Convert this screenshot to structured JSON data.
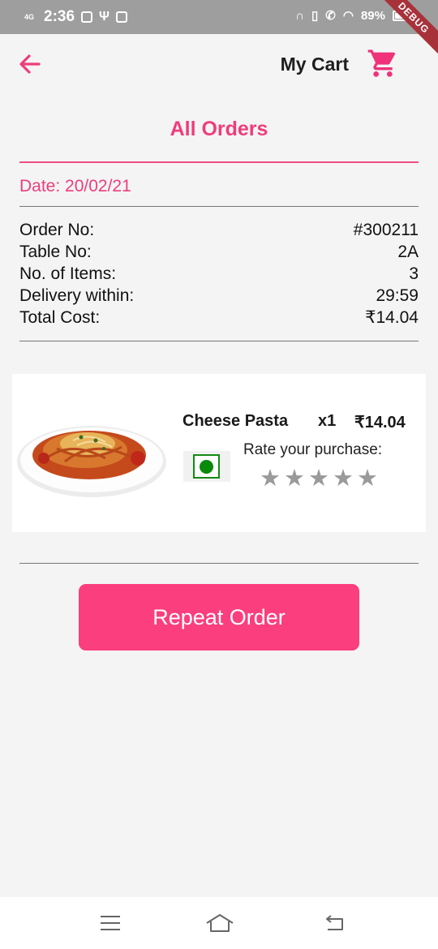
{
  "status_bar": {
    "network": "4G",
    "time": "2:36",
    "battery": "89%"
  },
  "debug_banner": "DEBUG",
  "header": {
    "cart_label": "My Cart"
  },
  "page_title": "All Orders",
  "order": {
    "date": "Date: 20/02/21",
    "details": [
      {
        "label": "Order No:",
        "value": "#300211"
      },
      {
        "label": "Table No:",
        "value": "2A"
      },
      {
        "label": "No. of Items:",
        "value": "3"
      },
      {
        "label": "Delivery within:",
        "value": "29:59"
      },
      {
        "label": "Total Cost:",
        "value": "₹14.04"
      }
    ],
    "item": {
      "name": "Cheese Pasta",
      "qty": "x1",
      "price": "₹14.04",
      "rate_label": "Rate your purchase:",
      "rating": 0,
      "max_rating": 5
    }
  },
  "repeat_button": "Repeat Order",
  "colors": {
    "accent": "#ee3d7b",
    "button": "#fb3e7d",
    "veg": "#0a8a0a",
    "star_empty": "#9a9a9a"
  }
}
